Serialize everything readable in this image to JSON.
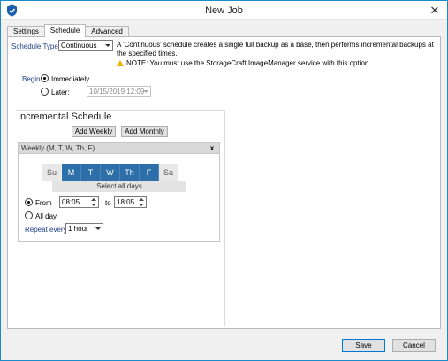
{
  "window": {
    "title": "New Job"
  },
  "tabs": [
    {
      "label": "Settings",
      "active": false
    },
    {
      "label": "Schedule",
      "active": true
    },
    {
      "label": "Advanced",
      "active": false
    }
  ],
  "schedule": {
    "type_label": "Schedule Type",
    "type_value": "Continuous",
    "description": "A 'Continuous' schedule creates a single full backup as a base, then performs incremental backups at the specified times.",
    "note": "NOTE: You must use the StorageCraft ImageManager service with this option.",
    "begin_label": "Begin",
    "immediately_label": "Immediately",
    "immediately_checked": true,
    "later_label": "Later:",
    "later_checked": false,
    "later_value": "10/15/2019 12:09"
  },
  "incremental": {
    "title": "Incremental Schedule",
    "add_weekly": "Add Weekly",
    "add_monthly": "Add Monthly",
    "entry_header": "Weekly (M, T, W, Th, F)",
    "entry_close": "x",
    "days": [
      {
        "label": "Su",
        "selected": false
      },
      {
        "label": "M",
        "selected": true
      },
      {
        "label": "T",
        "selected": true
      },
      {
        "label": "W",
        "selected": true
      },
      {
        "label": "Th",
        "selected": true
      },
      {
        "label": "F",
        "selected": true
      },
      {
        "label": "Sa",
        "selected": false
      }
    ],
    "select_all": "Select all days",
    "from_label": "From",
    "from_checked": true,
    "from_value": "08:05",
    "to_label": "to",
    "to_value": "18:05",
    "allday_label": "All day",
    "allday_checked": false,
    "repeat_label": "Repeat every",
    "repeat_value": "1 hour"
  },
  "footer": {
    "save": "Save",
    "cancel": "Cancel"
  },
  "colors": {
    "accent": "#1e9ad6",
    "day_selected": "#2d6fa8",
    "warning": "#e8b400"
  }
}
